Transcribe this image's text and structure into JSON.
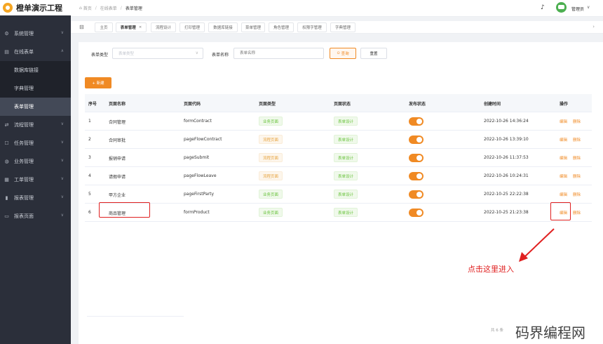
{
  "app": {
    "title": "橙单演示工程"
  },
  "sidebar": {
    "items": [
      {
        "label": "系统管理",
        "icon": "gear-icon"
      },
      {
        "label": "在线表单",
        "icon": "form-icon"
      },
      {
        "label": "流程管理",
        "icon": "flow-icon"
      },
      {
        "label": "任务管理",
        "icon": "task-icon"
      },
      {
        "label": "业务管理",
        "icon": "business-icon"
      },
      {
        "label": "工单管理",
        "icon": "grid-icon"
      },
      {
        "label": "报表管理",
        "icon": "bar-chart-icon"
      },
      {
        "label": "报表页面",
        "icon": "folder-icon"
      }
    ],
    "sub_items": [
      "数据库链接",
      "字典管理",
      "表单管理"
    ]
  },
  "breadcrumb": {
    "home": "首页",
    "level1": "在线表单",
    "current": "表单管理"
  },
  "header": {
    "user": "管理员"
  },
  "tabs": [
    "主页",
    "表单管理",
    "流程设计",
    "打印管理",
    "数据库链接",
    "菜单管理",
    "角色管理",
    "权限字管理",
    "字典管理"
  ],
  "filters": {
    "type_label": "表单类型",
    "type_placeholder": "表单类型",
    "name_label": "表单名称",
    "name_placeholder": "表单名称",
    "query_label": "查询",
    "reset_label": "重置"
  },
  "toolbar": {
    "add_label": "+ 新建"
  },
  "table": {
    "headers": [
      "序号",
      "页面名称",
      "页面代码",
      "页面类型",
      "页面状态",
      "发布状态",
      "创建时间",
      "操作"
    ],
    "rows": [
      {
        "no": "1",
        "name": "合同管理",
        "code": "formContract",
        "type": "业务页面",
        "status": "表单设计",
        "time": "2022-10-26 14:36:24"
      },
      {
        "no": "2",
        "name": "合同审批",
        "code": "pageFlowContract",
        "type": "流程页面",
        "status": "表单设计",
        "time": "2022-10-26 13:39:10"
      },
      {
        "no": "3",
        "name": "报销申请",
        "code": "pageSubmit",
        "type": "流程页面",
        "status": "表单设计",
        "time": "2022-10-26 11:37:53"
      },
      {
        "no": "4",
        "name": "请假申请",
        "code": "pageFlowLeave",
        "type": "流程页面",
        "status": "表单设计",
        "time": "2022-10-26 10:24:31"
      },
      {
        "no": "5",
        "name": "甲方企业",
        "code": "pageFirstParty",
        "type": "业务页面",
        "status": "表单设计",
        "time": "2022-10-25 22:22:38"
      },
      {
        "no": "6",
        "name": "商品管理",
        "code": "formProduct",
        "type": "业务页面",
        "status": "表单设计",
        "time": "2022-10-25 21:23:38"
      }
    ],
    "edit_label": "编辑",
    "delete_label": "删除"
  },
  "annotation": {
    "text": "点击这里进入"
  },
  "pager": {
    "text": "共 6 条"
  },
  "watermark": {
    "text": "码界编程网"
  },
  "colors": {
    "accent": "#f08a24",
    "sidebar": "#2b2f3a",
    "annotation": "#e02020"
  }
}
